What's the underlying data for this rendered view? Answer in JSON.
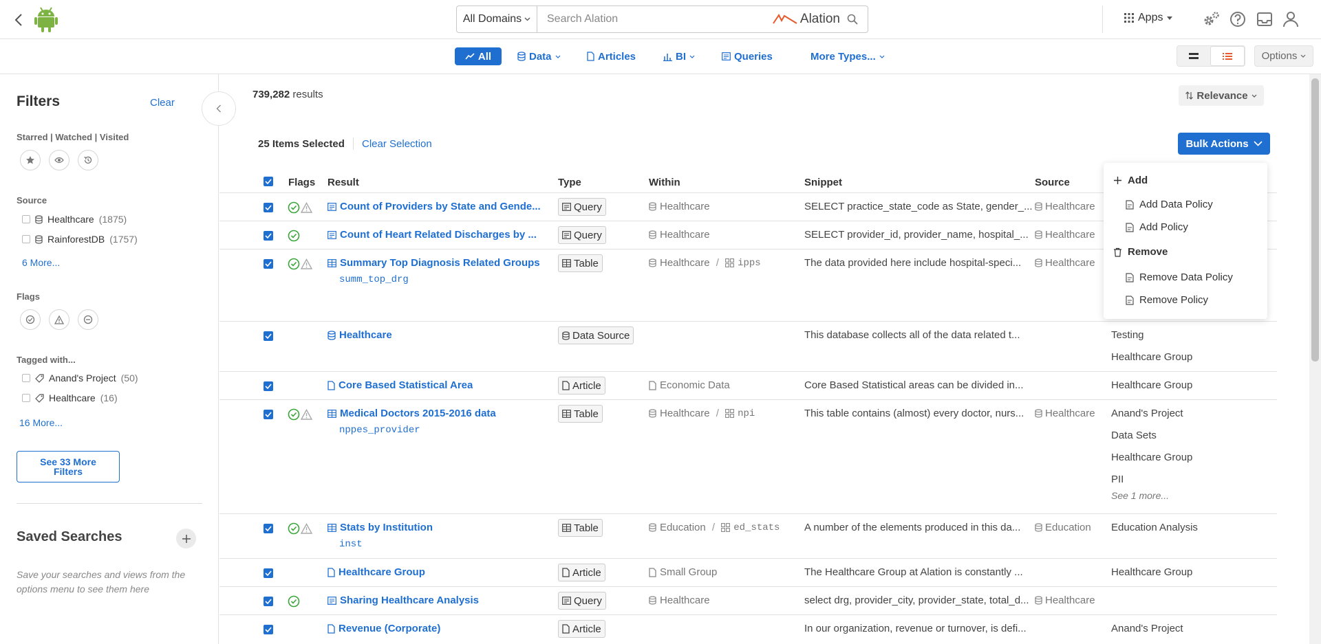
{
  "header": {
    "domain_select": "All Domains",
    "search_placeholder": "Search Alation",
    "brand": "Alation",
    "apps_label": "Apps"
  },
  "type_tabs": {
    "all": "All",
    "data": "Data",
    "articles": "Articles",
    "bi": "BI",
    "queries": "Queries",
    "more_types": "More Types...",
    "options": "Options"
  },
  "sidebar": {
    "title": "Filters",
    "clear": "Clear",
    "starred_section": "Starred | Watched | Visited",
    "source_section": "Source",
    "sources": [
      {
        "label": "Healthcare",
        "count": "(1875)"
      },
      {
        "label": "RainforestDB",
        "count": "(1757)"
      }
    ],
    "source_more": "6 More...",
    "flags_section": "Flags",
    "tagged_section": "Tagged with...",
    "tags": [
      {
        "label": "Anand's Project",
        "count": "(50)"
      },
      {
        "label": "Healthcare",
        "count": "(16)"
      }
    ],
    "tags_more": "16 More...",
    "see_more_filters": "See 33 More Filters",
    "saved_title": "Saved Searches",
    "saved_hint": "Save your searches and views from the options menu to see them here"
  },
  "results": {
    "count": "739,282",
    "count_suffix": " results",
    "sort": "Relevance",
    "selected": "25 Items Selected",
    "clear_selection": "Clear Selection",
    "bulk_actions": "Bulk Actions"
  },
  "table": {
    "columns": {
      "flags": "Flags",
      "result": "Result",
      "type": "Type",
      "within": "Within",
      "snippet": "Snippet",
      "source": "Source"
    },
    "rows": [
      {
        "name": "Count of Providers by State and Gende...",
        "type": "Query",
        "within": "Healthcare",
        "snippet": "SELECT practice_state_code as State, gender_...",
        "source": "Healthcare"
      },
      {
        "name": "Count of Heart Related Discharges by ...",
        "type": "Query",
        "within": "Healthcare",
        "snippet": "SELECT provider_id, provider_name, hospital_...",
        "source": "Healthcare"
      },
      {
        "name": "Summary Top Diagnosis Related Groups",
        "sub": "summ_top_drg",
        "type": "Table",
        "within": "Healthcare",
        "schema": "ipps",
        "snippet": "The data provided here include hospital-speci...",
        "source": "Healthcare"
      },
      {
        "name": "Healthcare",
        "type": "Data Source",
        "snippet": "This database collects all of the data related t...",
        "tags": [
          "Testing",
          "Healthcare Group"
        ]
      },
      {
        "name": "Core Based Statistical Area",
        "type": "Article",
        "within": "Economic Data",
        "snippet": "Core Based Statistical areas can be divided in...",
        "tags": [
          "Healthcare Group"
        ]
      },
      {
        "name": "Medical Doctors 2015-2016 data",
        "sub": "nppes_provider",
        "type": "Table",
        "within": "Healthcare",
        "schema": "npi",
        "snippet": "This table contains (almost) every doctor, nurs...",
        "source": "Healthcare",
        "tags": [
          "Anand's Project",
          "Data Sets",
          "Healthcare Group",
          "PII"
        ],
        "see_more": "See 1 more..."
      },
      {
        "name": "Stats by Institution",
        "sub": "inst",
        "type": "Table",
        "within": "Education",
        "schema": "ed_stats",
        "snippet": "A number of the elements produced in this da...",
        "source": "Education",
        "tags": [
          "Education Analysis"
        ]
      },
      {
        "name": "Healthcare Group",
        "type": "Article",
        "within": "Small Group",
        "snippet": "The Healthcare Group at Alation is constantly ...",
        "tags": [
          "Healthcare Group"
        ]
      },
      {
        "name": "Sharing Healthcare Analysis",
        "type": "Query",
        "within": "Healthcare",
        "snippet": "select drg, provider_city, provider_state, total_d...",
        "source": "Healthcare"
      },
      {
        "name": "Revenue (Corporate)",
        "type": "Article",
        "snippet": "In our organization, revenue or turnover, is defi...",
        "tags": [
          "Anand's Project"
        ]
      }
    ]
  },
  "bulk_menu": {
    "add": "Add",
    "add_data_policy": "Add Data Policy",
    "add_policy": "Add Policy",
    "remove": "Remove",
    "remove_data_policy": "Remove Data Policy",
    "remove_policy": "Remove Policy"
  },
  "colors": {
    "accent": "#1f6fd1",
    "endorsed": "#3aa53a",
    "android": "#7cb342",
    "brand": "#e8582a"
  }
}
